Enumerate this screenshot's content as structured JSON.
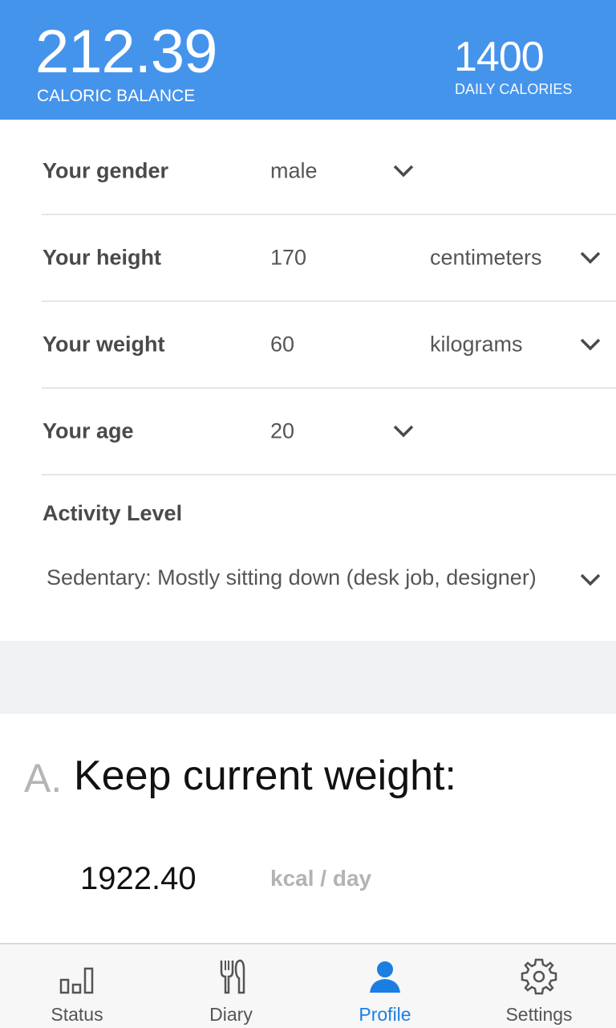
{
  "header": {
    "balance_value": "212.39",
    "balance_label": "CALORIC BALANCE",
    "daily_value": "1400",
    "daily_label": "DAILY CALORIES",
    "bg_color": "#4594ec"
  },
  "profile": {
    "gender": {
      "label": "Your gender",
      "value": "male"
    },
    "height": {
      "label": "Your height",
      "value": "170",
      "unit": "centimeters"
    },
    "weight": {
      "label": "Your weight",
      "value": "60",
      "unit": "kilograms"
    },
    "age": {
      "label": "Your age",
      "value": "20"
    },
    "activity": {
      "label": "Activity Level",
      "value": "Sedentary: Mostly sitting down (desk job, designer)"
    }
  },
  "goal": {
    "letter": "A.",
    "title": "Keep current weight:",
    "value": "1922.40",
    "unit": "kcal / day"
  },
  "nav": {
    "items": [
      {
        "label": "Status",
        "icon": "bar-chart-icon"
      },
      {
        "label": "Diary",
        "icon": "fork-knife-icon"
      },
      {
        "label": "Profile",
        "icon": "person-icon",
        "active": true
      },
      {
        "label": "Settings",
        "icon": "gear-icon"
      }
    ],
    "active_color": "#1b7ee3"
  }
}
